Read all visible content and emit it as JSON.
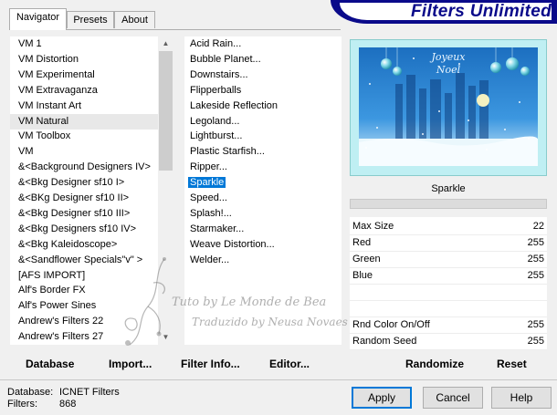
{
  "tabs": [
    {
      "label": "Navigator",
      "active": true
    },
    {
      "label": "Presets",
      "active": false
    },
    {
      "label": "About",
      "active": false
    }
  ],
  "brand": {
    "title": "Filters Unlimited"
  },
  "categories": [
    {
      "label": "VM 1"
    },
    {
      "label": "VM Distortion"
    },
    {
      "label": "VM Experimental"
    },
    {
      "label": "VM Extravaganza"
    },
    {
      "label": "VM Instant Art"
    },
    {
      "label": "VM Natural",
      "highlighted": true
    },
    {
      "label": "VM Toolbox"
    },
    {
      "label": "VM"
    },
    {
      "label": "&<Background Designers IV>"
    },
    {
      "label": "&<Bkg Designer sf10 I>"
    },
    {
      "label": "&<BKg Designer sf10 II>"
    },
    {
      "label": "&<Bkg Designer sf10 III>"
    },
    {
      "label": "&<Bkg Designers sf10 IV>"
    },
    {
      "label": "&<Bkg Kaleidoscope>"
    },
    {
      "label": "&<Sandflower Specials\"v\" >"
    },
    {
      "label": "[AFS IMPORT]"
    },
    {
      "label": "Alf's Border FX"
    },
    {
      "label": "Alf's Power Sines"
    },
    {
      "label": "Andrew's Filters 22"
    },
    {
      "label": "Andrew's Filters 27"
    }
  ],
  "filters": [
    {
      "label": "Acid Rain..."
    },
    {
      "label": "Bubble Planet..."
    },
    {
      "label": "Downstairs..."
    },
    {
      "label": "Flipperballs"
    },
    {
      "label": "Lakeside Reflection"
    },
    {
      "label": "Legoland..."
    },
    {
      "label": "Lightburst..."
    },
    {
      "label": "Plastic Starfish..."
    },
    {
      "label": "Ripper..."
    },
    {
      "label": "Sparkle",
      "selected": true
    },
    {
      "label": "Speed..."
    },
    {
      "label": "Splash!..."
    },
    {
      "label": "Starmaker..."
    },
    {
      "label": "Weave Distortion..."
    },
    {
      "label": "Welder..."
    }
  ],
  "preview": {
    "filter_name": "Sparkle",
    "image_text_1": "Joyeux",
    "image_text_2": "Noel"
  },
  "params": [
    {
      "label": "Max Size",
      "value": "22"
    },
    {
      "label": "Red",
      "value": "255"
    },
    {
      "label": "Green",
      "value": "255"
    },
    {
      "label": "Blue",
      "value": "255"
    },
    {
      "label": "",
      "value": ""
    },
    {
      "label": "",
      "value": ""
    },
    {
      "label": "Rnd Color On/Off",
      "value": "255"
    },
    {
      "label": "Random Seed",
      "value": "255"
    }
  ],
  "toolbar": {
    "database": "Database",
    "import": "Import...",
    "filter_info": "Filter Info...",
    "editor": "Editor...",
    "randomize": "Randomize",
    "reset": "Reset"
  },
  "status": {
    "database_label": "Database:",
    "database_value": "ICNET Filters",
    "filters_label": "Filters:",
    "filters_value": "868"
  },
  "buttons": {
    "apply": "Apply",
    "cancel": "Cancel",
    "help": "Help"
  },
  "watermark": {
    "line1": "Tuto by Le Monde de Bea",
    "line2": "Traduzido by Neusa Novaes"
  },
  "colors": {
    "brand": "#0a0a8a",
    "selection": "#0078d7"
  }
}
